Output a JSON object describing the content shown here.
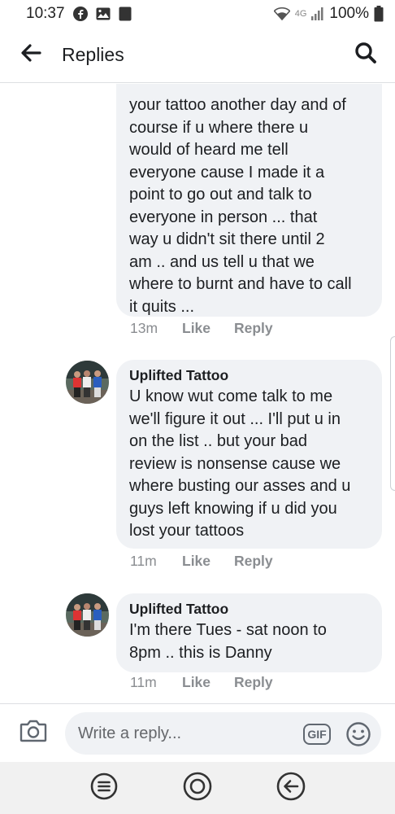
{
  "status_bar": {
    "time": "10:37",
    "notification_badge": "100",
    "network": "4G",
    "battery": "100%"
  },
  "header": {
    "title": "Replies"
  },
  "comments": [
    {
      "author": "",
      "text": "your tattoo another day and of\ncourse if u where there u\nwould of heard me tell\neveryone cause I made it a\npoint to go out and talk to\neveryone in person ...  that\nway u didn't sit there until 2\nam .. and us tell u that we\nwhere to burnt and have to call\nit quits ...",
      "time": "13m",
      "like": "Like",
      "reply": "Reply"
    },
    {
      "author": "Uplifted Tattoo",
      "text": "U know wut come talk to me\nwe'll figure it out ... I'll put u in\non the list .. but your bad\nreview is nonsense cause we\nwhere busting our asses and u\nguys left knowing if u did you\nlost your tattoos",
      "time": "11m",
      "like": "Like",
      "reply": "Reply"
    },
    {
      "author": "Uplifted Tattoo",
      "text": "I'm there Tues - sat noon to\n8pm .. this is Danny",
      "time": "11m",
      "like": "Like",
      "reply": "Reply"
    }
  ],
  "composer": {
    "placeholder": "Write a reply...",
    "gif_label": "GIF"
  },
  "icons": {
    "back": "arrow-left-icon",
    "search": "search-icon",
    "camera": "camera-icon",
    "emoji": "emoji-icon",
    "nav_recents": "recents-icon",
    "nav_home": "home-icon",
    "nav_back": "back-icon"
  },
  "colors": {
    "bubble": "#f0f2f5",
    "meta_text": "#8a8d91",
    "primary_text": "#1c1e21"
  }
}
